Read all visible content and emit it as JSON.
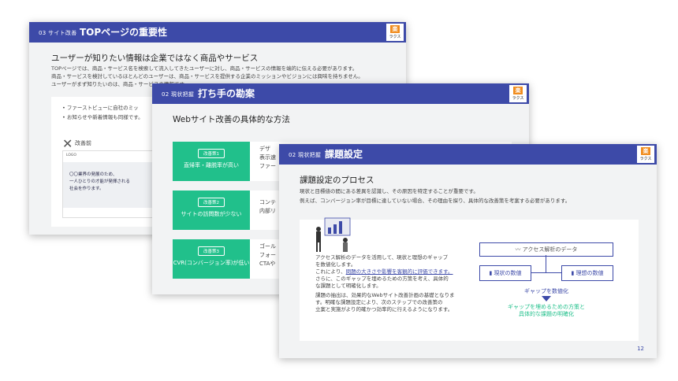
{
  "logo": {
    "mark": "楽",
    "text": "ラクス"
  },
  "slide1": {
    "section_num": "03 サイト改善",
    "title": "TOPページの重要性",
    "subtitle": "ユーザーが知りたい情報は企業ではなく商品やサービス",
    "body": [
      "TOPページでは、商品・サービス名を検索して流入してきたユーザーに対し、商品・サービスの情報を端的に伝える必要があります。",
      "商品・サービスを検討しているほとんどのユーザーは、商品・サービスを提供する企業のミッションやビジョンには興味を持ちません。",
      "ユーザーがまず知りたいのは、商品・サービスの情報です。"
    ],
    "bullets": [
      "ファーストビューに自社のミッ",
      "お知らせや新着情報も同様です。"
    ],
    "bad_label": "改善前",
    "mock": {
      "logo": "LOGO",
      "hero": [
        "〇〇業界の発展のため、",
        "一人ひとりの才能が発揮される",
        "社会を作ります。"
      ]
    }
  },
  "slide2": {
    "section_num": "02 現状把握",
    "title": "打ち手の勘案",
    "subtitle": "Webサイト改善の具体的な方法",
    "rows": [
      {
        "tag": "改善策1",
        "label": "直帰率・離脱率が高い",
        "text": [
          "デザ",
          "表示速",
          "ファー"
        ]
      },
      {
        "tag": "改善策2",
        "label": "サイトの訪問数が少ない",
        "text": [
          "コンテ",
          "内部リ"
        ]
      },
      {
        "tag": "改善策3",
        "label": "CVR(コンバージョン率)が低い",
        "text": [
          "ゴール",
          "フォー",
          "CTAや"
        ]
      }
    ]
  },
  "slide3": {
    "section_num": "02 現状把握",
    "title": "課題設定",
    "subtitle": "課題設定のプロセス",
    "body": [
      "現状と目標値の間にある差異を認識し、その原因を特定することが重要です。",
      "例えば、コンバージョン率が目標に達していない場合、その理由を探り、具体的な改善策を考案する必要があります。"
    ],
    "panel_text": [
      "アクセス解析のデータを活用して、現状と理想のギャップ",
      "を数値化します。",
      "これにより、",
      "問題の大きさや影響を客観的に評価できます。",
      "さらに、このギャップを埋めるための方策を考え、具体的",
      "な課題として明確化します。",
      "課題の抽出は、効果的なWebサイト改善計画の基礎となりま",
      "す。明確な課題設定により、次のステップでの改善策の",
      "立案と実施がより的確かつ効率的に行えるようになります。"
    ],
    "diagram": {
      "top": "アクセス解析のデータ",
      "left": "現状の数値",
      "right": "理想の数値",
      "mid": "ギャップを数値化",
      "bottom": [
        "ギャップを埋めるための方策と",
        "具体的な課題の明確化"
      ]
    },
    "page_number": "12"
  },
  "colors": {
    "header": "#3d4aa8",
    "accent_green": "#21c08b",
    "logo_orange": "#f08c1e"
  }
}
